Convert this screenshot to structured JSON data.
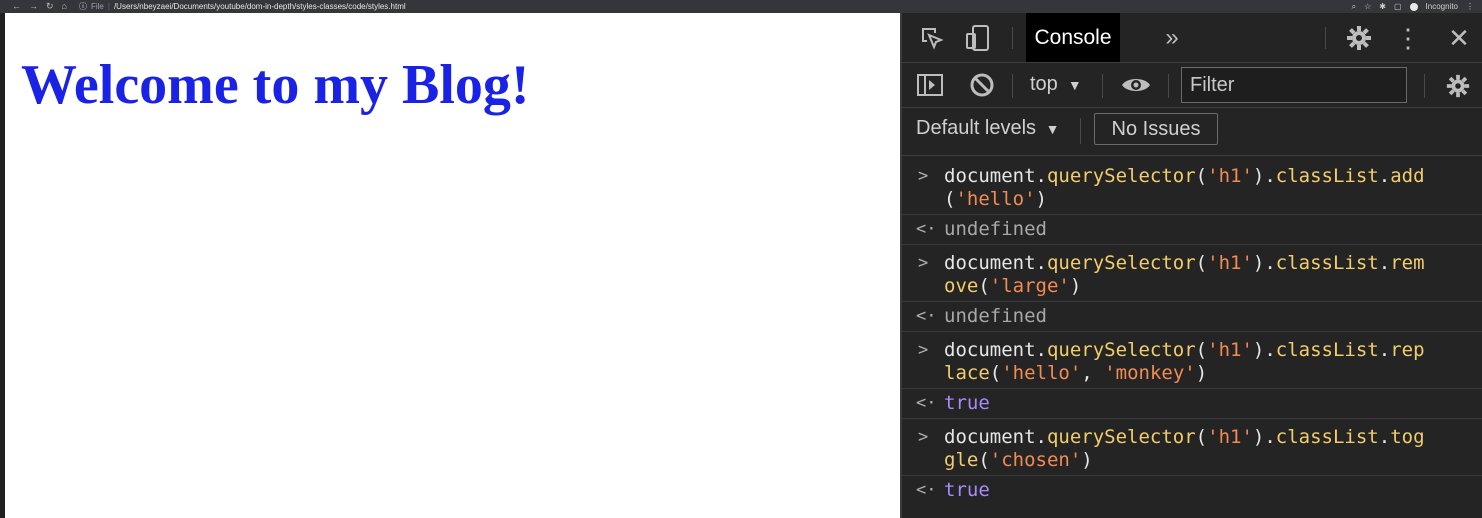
{
  "browser": {
    "file_label": "File",
    "url": "/Users/nbeyzaei/Documents/youtube/dom-in-depth/styles-classes/code/styles.html",
    "incognito_label": "Incognito"
  },
  "page": {
    "heading": "Welcome to my Blog!"
  },
  "devtools": {
    "active_tab": "Console",
    "context": "top",
    "filter_placeholder": "Filter",
    "levels_label": "Default levels",
    "issues_label": "No Issues",
    "entries": [
      {
        "cmd": {
          "obj": "document.",
          "m1": "querySelector",
          "a1": "(",
          "s1": "'h1'",
          "a2": ").",
          "m2": "classList",
          "a3": ".",
          "m3a": "add",
          "m3b": "",
          "a4": "(",
          "s2": "'hello'",
          "a5": ")"
        },
        "result": "undefined"
      },
      {
        "cmd": {
          "obj": "document.",
          "m1": "querySelector",
          "a1": "(",
          "s1": "'h1'",
          "a2": ").",
          "m2": "classList",
          "a3": ".",
          "m3a": "rem",
          "m3b": "ove",
          "a4": "(",
          "s2": "'large'",
          "a5": ")"
        },
        "result": "undefined"
      },
      {
        "cmd": {
          "obj": "document.",
          "m1": "querySelector",
          "a1": "(",
          "s1": "'h1'",
          "a2": ").",
          "m2": "classList",
          "a3": ".",
          "m3a": "rep",
          "m3b": "lace",
          "a4": "(",
          "s2": "'hello'",
          "a5": ", ",
          "s3": "'monkey'",
          "a6": ")"
        },
        "result": "true"
      },
      {
        "cmd": {
          "obj": "document.",
          "m1": "querySelector",
          "a1": "(",
          "s1": "'h1'",
          "a2": ").",
          "m2": "classList",
          "a3": ".",
          "m3a": "tog",
          "m3b": "gle",
          "a4": "(",
          "s2": "'chosen'",
          "a5": ")"
        },
        "result": "true"
      }
    ]
  },
  "colors": {
    "heading": "#1a22e6",
    "method": "#f2cd6b",
    "string": "#f28b54",
    "boolean": "#a78bfa"
  }
}
